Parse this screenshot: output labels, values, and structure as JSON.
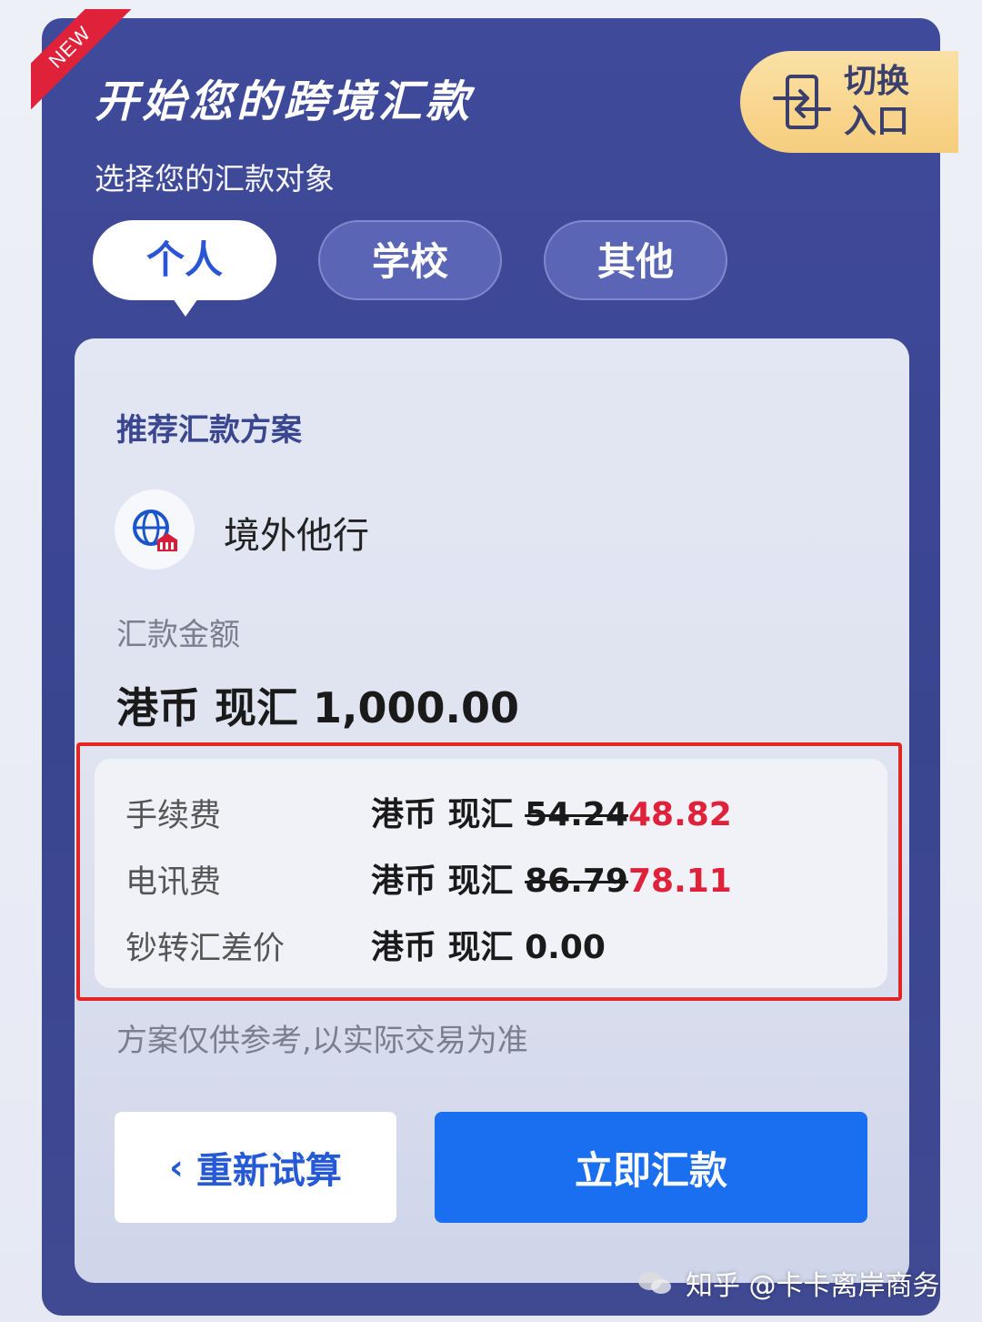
{
  "badge": {
    "text": "NEW"
  },
  "header": {
    "title": "开始您的跨境汇款",
    "switch_label_line1": "切换",
    "switch_label_line2": "入口",
    "subtitle": "选择您的汇款对象"
  },
  "tabs": [
    {
      "label": "个人",
      "active": true
    },
    {
      "label": "学校",
      "active": false
    },
    {
      "label": "其他",
      "active": false
    }
  ],
  "plan": {
    "section_title": "推荐汇款方案",
    "bank_name": "境外他行",
    "amount_label": "汇款金额",
    "amount_value": "港币 现汇 1,000.00",
    "fees": [
      {
        "label": "手续费",
        "currency": "港币 现汇",
        "original": "54.24",
        "discounted": "48.82"
      },
      {
        "label": "电讯费",
        "currency": "港币 现汇",
        "original": "86.79",
        "discounted": "78.11"
      },
      {
        "label": "钞转汇差价",
        "currency": "港币 现汇",
        "value": "0.00"
      }
    ],
    "note": "方案仅供参考,以实际交易为准"
  },
  "buttons": {
    "recalc": "重新试算",
    "pay": "立即汇款"
  },
  "watermark": {
    "text": "知乎 @卡卡离岸商务"
  },
  "colors": {
    "primary": "#1a6ef0",
    "accent_red": "#e0213a",
    "panel": "#3f4a9a"
  }
}
